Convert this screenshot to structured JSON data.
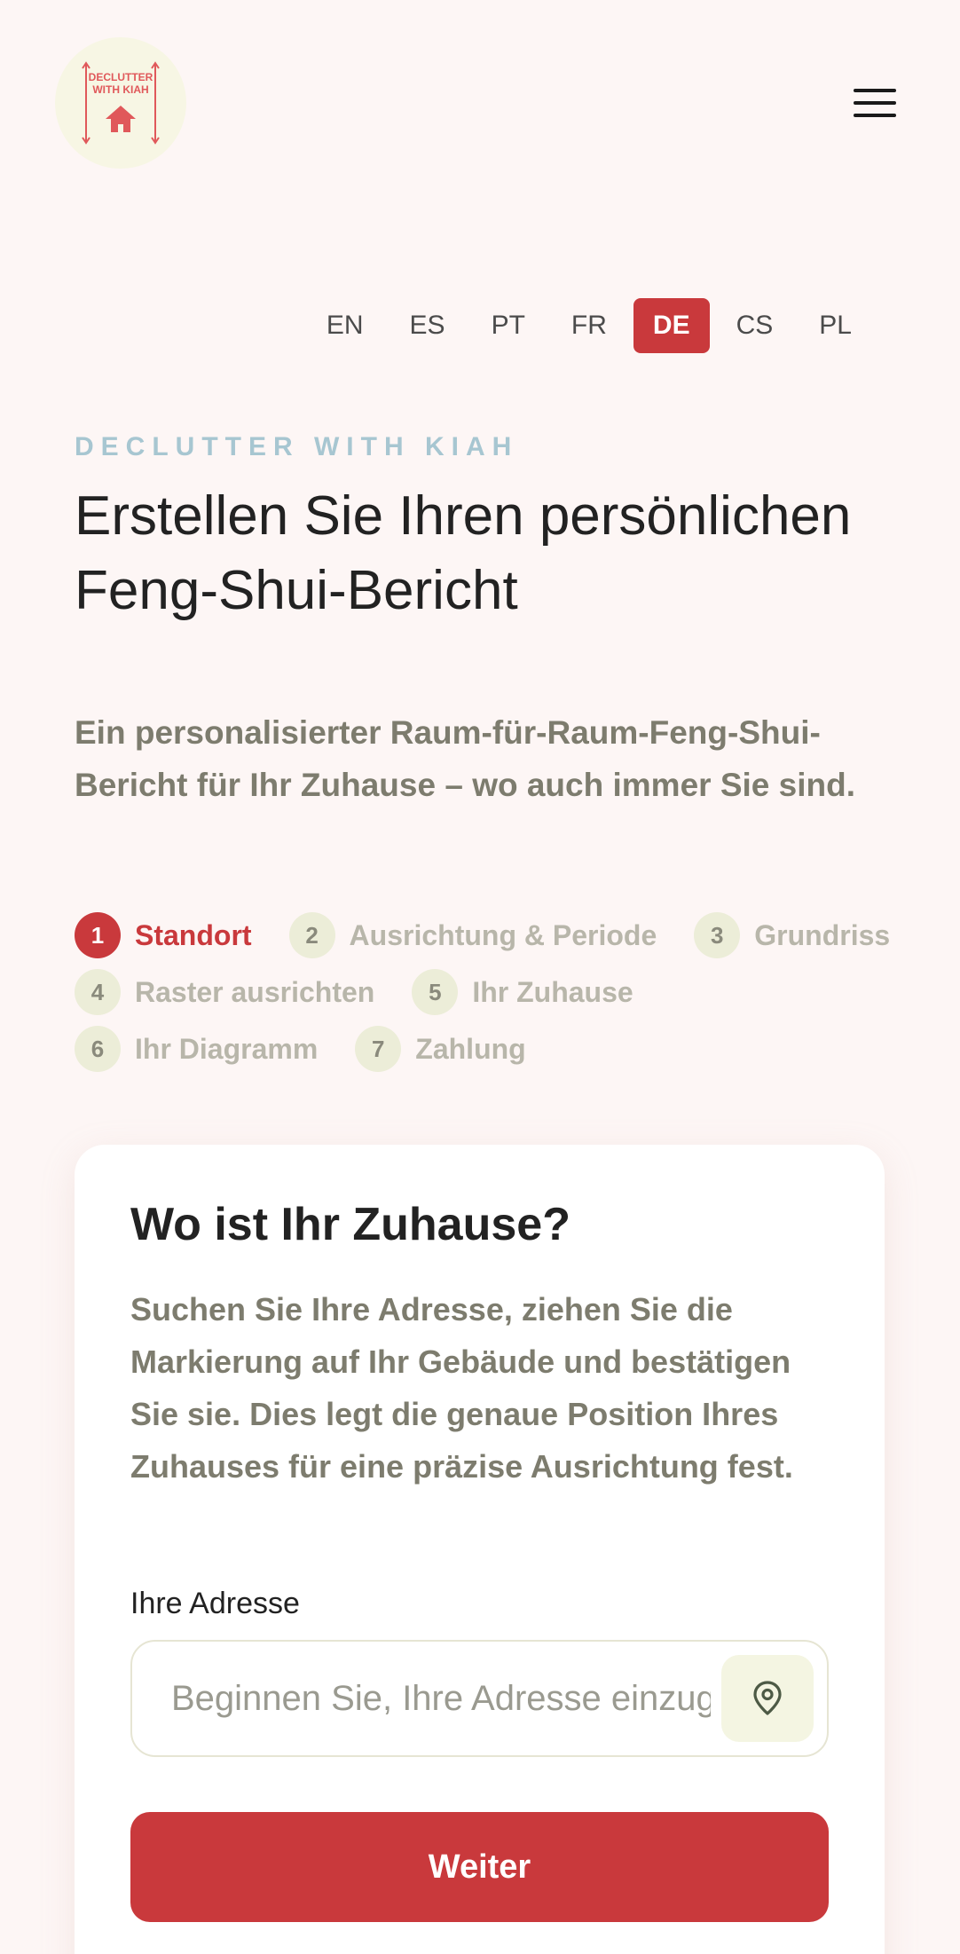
{
  "header": {
    "logo_text": "DECLUTTER WITH KIAH",
    "brand_color": "#c9393c"
  },
  "languages": [
    {
      "code": "EN",
      "active": false
    },
    {
      "code": "ES",
      "active": false
    },
    {
      "code": "PT",
      "active": false
    },
    {
      "code": "FR",
      "active": false
    },
    {
      "code": "DE",
      "active": true
    },
    {
      "code": "CS",
      "active": false
    },
    {
      "code": "PL",
      "active": false
    }
  ],
  "hero": {
    "eyebrow": "DECLUTTER WITH KIAH",
    "title": "Erstellen Sie Ihren persönlichen Feng-Shui-Bericht",
    "subtitle": "Ein personalisierter Raum-für-Raum-Feng-Shui-Bericht für Ihr Zuhause – wo auch immer Sie sind."
  },
  "steps": [
    {
      "number": "1",
      "label": "Standort",
      "active": true
    },
    {
      "number": "2",
      "label": "Ausrichtung & Periode",
      "active": false
    },
    {
      "number": "3",
      "label": "Grundriss",
      "active": false
    },
    {
      "number": "4",
      "label": "Raster ausrichten",
      "active": false
    },
    {
      "number": "5",
      "label": "Ihr Zuhause",
      "active": false
    },
    {
      "number": "6",
      "label": "Ihr Diagramm",
      "active": false
    },
    {
      "number": "7",
      "label": "Zahlung",
      "active": false
    }
  ],
  "card": {
    "title": "Wo ist Ihr Zuhause?",
    "description": "Suchen Sie Ihre Adresse, ziehen Sie die Markierung auf Ihr Gebäude und bestätigen Sie sie. Dies legt die genaue Position Ihres Zuhauses für eine präzise Ausrichtung fest.",
    "address_label": "Ihre Adresse",
    "address_placeholder": "Beginnen Sie, Ihre Adresse einzugeben",
    "address_value": "",
    "locate_icon": "map-pin-icon",
    "next_label": "Weiter"
  }
}
